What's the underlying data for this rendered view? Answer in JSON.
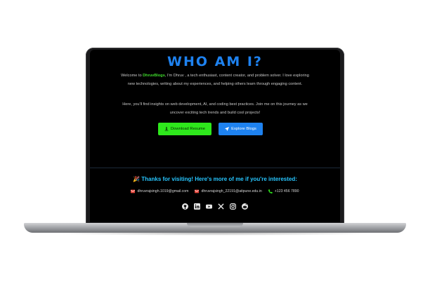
{
  "hero": {
    "title": "WHO AM I?",
    "intro_prefix": "Welcome to ",
    "brand": "DhruvBlogs",
    "intro_rest": ", I'm Dhruv , a tech enthusiast, content creator, and problem solver. I love exploring new technologies, writing about my experiences, and helping others learn through engaging content.",
    "paragraph2": "Here, you'll find insights on web development, AI, and coding best practices. Join me on this journey as we uncover exciting tech trends and build cool projects!",
    "download_label": "Download Resume",
    "explore_label": "Explore Blogs"
  },
  "footer": {
    "title": "🎉 Thanks for visiting! Here's more of me if you're interested:",
    "email1": "dhruvrajsingh.1019@gmail.com",
    "email2": "dhruvrajsingh_22191@aitpune.edu.in",
    "phone": "+123 456 7890",
    "socials": [
      "github-icon",
      "linkedin-icon",
      "youtube-icon",
      "x-icon",
      "instagram-icon",
      "reddit-icon"
    ]
  },
  "colors": {
    "accent_blue": "#1e82f0",
    "accent_green": "#2ee81c",
    "footer_title": "#27c6ff",
    "email_icon": "#e8473c",
    "phone_icon": "#2ee81c"
  }
}
